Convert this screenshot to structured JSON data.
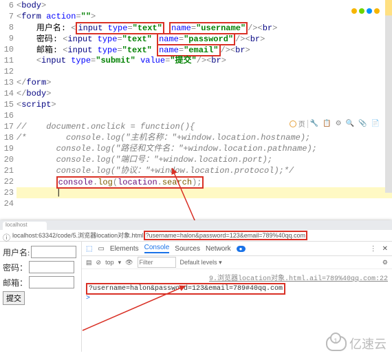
{
  "editor": {
    "line_numbers": [
      "6",
      "7",
      "8",
      "9",
      "10",
      "11",
      "12",
      "13",
      "14",
      "15",
      "16",
      "17",
      "18",
      "19",
      "20",
      "21",
      "22",
      "23",
      "24"
    ],
    "cursor_line": "23",
    "code": {
      "l6": {
        "tag_open": "body",
        "gt": ">"
      },
      "l7": {
        "tag": "form",
        "attr": "action",
        "attr_val": "\"\"",
        "gt": ">"
      },
      "l8": {
        "label": "用户名:",
        "tag": "input",
        "a1": "type",
        "v1": "\"text\"",
        "a2": "name",
        "v2": "\"username\"",
        "end": "/><",
        "br": "br",
        "gt": ">"
      },
      "l9": {
        "label": "密码:",
        "tag": "input",
        "a1": "type",
        "v1": "\"text\"",
        "a2": "name",
        "v2": "\"password\"",
        "end": "/><",
        "br": "br",
        "gt": ">"
      },
      "l10": {
        "label": "邮箱:",
        "tag": "input",
        "a1": "type",
        "v1": "\"text\"",
        "a2": "name",
        "v2": "\"email\"",
        "end": "/><",
        "br": "br",
        "gt": ">"
      },
      "l11": {
        "tag": "input",
        "a1": "type",
        "v1": "\"submit\"",
        "a2": "value",
        "v2": "\"提交\"",
        "end": "/><",
        "br": "br",
        "gt": ">"
      },
      "l13": {
        "close": "form"
      },
      "l14": {
        "close": "body"
      },
      "l15": {
        "tag": "script",
        "gt": ">"
      },
      "l17": {
        "text": "//    document.onclick = function(){"
      },
      "l18": {
        "text": "/*        console.log(\"主机名称：\"+window.location.hostname);"
      },
      "l19": {
        "text": "        console.log(\"路径和文件名：\"+window.location.pathname);"
      },
      "l20": {
        "text": "        console.log(\"端口号：\"+window.location.port);"
      },
      "l21": {
        "text": "        console.log(\"协议：\"+window.location.protocol);*/"
      },
      "l22": {
        "obj": "console",
        "dot": ".",
        "fn": "log",
        "p1": "(",
        "arg1": "location",
        "dot2": ".",
        "arg2": "search",
        "p2": ");"
      }
    },
    "toolbar_icons": [
      "●",
      "●",
      "●",
      "●"
    ],
    "toolbar2": {
      "letter": "页",
      "icons": "🔧 📋 ⚙ 🔍 📎 📄"
    }
  },
  "browser": {
    "tab_title": "localhost",
    "host": "localhost:63342/code/5.浏览器location对象.html",
    "query": "?username=halon&password=123&email=789%40qq.com",
    "page": {
      "row1_label": "用户名:",
      "row2_label": "密码：",
      "row3_label": "邮箱：",
      "submit": "提交"
    },
    "devtools": {
      "tabs": [
        "Elements",
        "Console",
        "Sources",
        "Network"
      ],
      "active_tab": "Console",
      "toolbar": {
        "clear": "⊘",
        "scope": "top",
        "eye": "👁",
        "filter_label": "Filter",
        "levels": "Default levels ▾",
        "gear": "⚙"
      },
      "source_link": "9.浏览器location对象.html.ail=789%40qq.com:22",
      "output": "?username=halon&password=123&email=789#40qq.com",
      "prompt": ">"
    }
  },
  "watermark": "亿速云"
}
